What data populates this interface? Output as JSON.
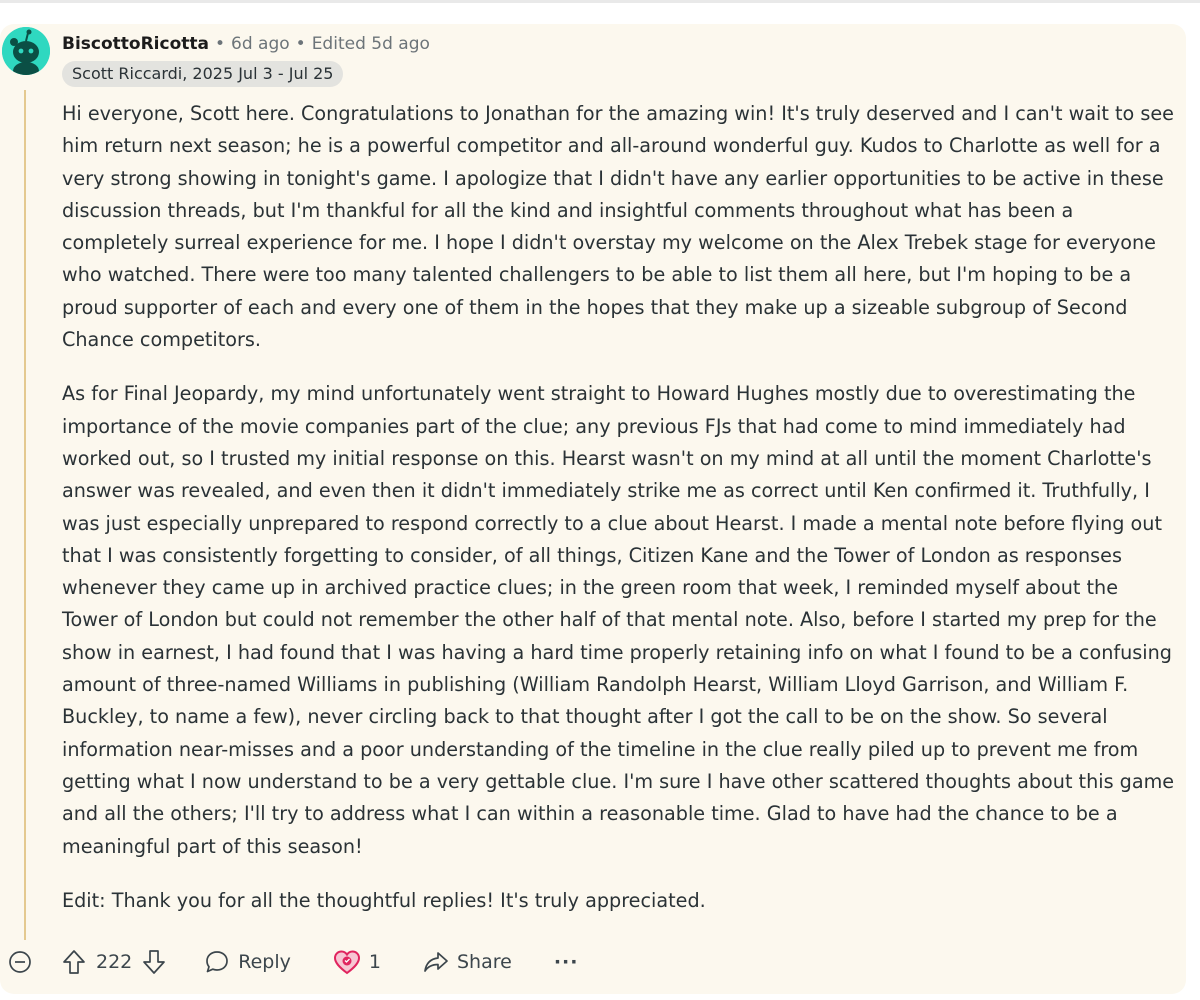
{
  "comment": {
    "username": "BiscottoRicotta",
    "posted": "6d ago",
    "edited": "Edited 5d ago",
    "flair": "Scott Riccardi, 2025 Jul 3 - Jul 25",
    "paragraphs": [
      "Hi everyone, Scott here. Congratulations to Jonathan for the amazing win! It's truly deserved and I can't wait to see him return next season; he is a powerful competitor and all-around wonderful guy. Kudos to Charlotte as well for a very strong showing in tonight's game. I apologize that I didn't have any earlier opportunities to be active in these discussion threads, but I'm thankful for all the kind and insightful comments throughout what has been a completely surreal experience for me. I hope I didn't overstay my welcome on the Alex Trebek stage for everyone who watched. There were too many talented challengers to be able to list them all here, but I'm hoping to be a proud supporter of each and every one of them in the hopes that they make up a sizeable subgroup of Second Chance competitors.",
      "As for Final Jeopardy, my mind unfortunately went straight to Howard Hughes mostly due to overestimating the importance of the movie companies part of the clue; any previous FJs that had come to mind immediately had worked out, so I trusted my initial response on this. Hearst wasn't on my mind at all until the moment Charlotte's answer was revealed, and even then it didn't immediately strike me as correct until Ken confirmed it. Truthfully, I was just especially unprepared to respond correctly to a clue about Hearst. I made a mental note before flying out that I was consistently forgetting to consider, of all things, Citizen Kane and the Tower of London as responses whenever they came up in archived practice clues; in the green room that week, I reminded myself about the Tower of London but could not remember the other half of that mental note. Also, before I started my prep for the show in earnest, I had found that I was having a hard time properly retaining info on what I found to be a confusing amount of three-named Williams in publishing (William Randolph Hearst, William Lloyd Garrison, and William F. Buckley, to name a few), never circling back to that thought after I got the call to be on the show. So several information near-misses and a poor understanding of the timeline in the clue really piled up to prevent me from getting what I now understand to be a very gettable clue. I'm sure I have other scattered thoughts about this game and all the others; I'll try to address what I can within a reasonable time. Glad to have had the chance to be a meaningful part of this season!",
      "Edit: Thank you for all the thoughtful replies! It's truly appreciated."
    ]
  },
  "actions": {
    "score": "222",
    "reply_label": "Reply",
    "award_count": "1",
    "share_label": "Share",
    "more_label": "···"
  },
  "icons": {
    "collapse": "minus-circle-icon",
    "upvote": "upvote-arrow-icon",
    "downvote": "downvote-arrow-icon",
    "reply": "speech-bubble-icon",
    "award": "heart-award-icon",
    "share": "share-arrow-icon"
  },
  "colors": {
    "card_background": "#fcf8ee",
    "avatar": "#2fd8c0",
    "thread_line": "#e4c98f",
    "award": "#e0245e"
  }
}
